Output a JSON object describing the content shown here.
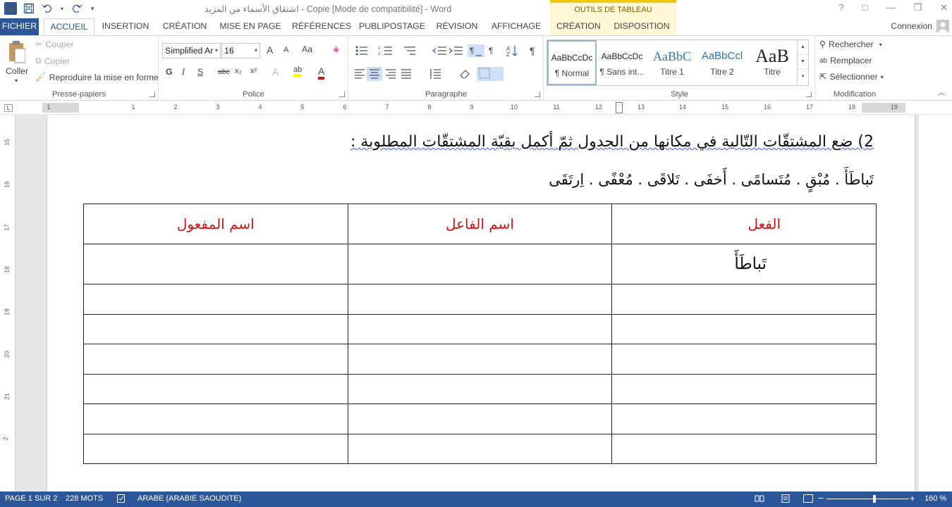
{
  "app": {
    "window_title": "اشتقاق الأسماء من المزيد - Copie [Mode de compatibilité] - Word",
    "contextual_group": "OUTILS DE TABLEAU",
    "window_controls": [
      "?",
      "□",
      "—",
      "❐",
      "✕"
    ]
  },
  "tabs": [
    {
      "label": "FICHIER"
    },
    {
      "label": "ACCUEIL"
    },
    {
      "label": "INSERTION"
    },
    {
      "label": "CRÉATION"
    },
    {
      "label": "MISE EN PAGE"
    },
    {
      "label": "RÉFÉRENCES"
    },
    {
      "label": "PUBLIPOSTAGE"
    },
    {
      "label": "RÉVISION"
    },
    {
      "label": "AFFICHAGE"
    },
    {
      "label": "CRÉATION"
    },
    {
      "label": "DISPOSITION"
    }
  ],
  "account": {
    "label": "Connexion"
  },
  "ribbon": {
    "clipboard": {
      "paste": "Coller",
      "cut": "Couper",
      "copy": "Copier",
      "format_painter": "Reproduire la mise en forme",
      "label": "Presse-papiers"
    },
    "font": {
      "family": "Simplified Ar",
      "size": "16",
      "label": "Police",
      "grow": "A",
      "shrink": "A",
      "case": "Aa",
      "bold": "G",
      "italic": "I",
      "underline": "S",
      "strike": "abc",
      "sub": "x₂",
      "sup": "x²",
      "text_effects": "A",
      "highlight": "ab",
      "color": "A"
    },
    "paragraph": {
      "label": "Paragraphe"
    },
    "styles": {
      "label": "Style",
      "items": [
        {
          "sample": "AaBbCcDc",
          "name": "¶ Normal"
        },
        {
          "sample": "AaBbCcDc",
          "name": "¶ Sans int..."
        },
        {
          "sample": "AaBbC",
          "name": "Titre 1"
        },
        {
          "sample": "AaBbCcl",
          "name": "Titre 2"
        },
        {
          "sample": "AaB",
          "name": "Titre"
        }
      ]
    },
    "editing": {
      "label": "Modification",
      "find": "Rechercher",
      "replace": "Remplacer",
      "select": "Sélectionner"
    }
  },
  "ruler": {
    "numbers": [
      "1",
      "1",
      "2",
      "3",
      "4",
      "5",
      "6",
      "7",
      "8",
      "9",
      "10",
      "11",
      "12",
      "13",
      "14",
      "15",
      "16",
      "17",
      "18",
      "19"
    ],
    "vertical_numbers": [
      "15",
      "16",
      "17",
      "18",
      "19",
      "20",
      "21",
      "2"
    ]
  },
  "document": {
    "question": "2) ضع المشتقّات التّالية في مكانها من الجدول ثمّ أكمل بقيّة المشتقّات المطلوبة :",
    "words": "تَباطَأَ . مُبْقٍ . مُتَسامًى . أَخفَى . تَلاقَى . مُعْفًى . اِرتَقَى",
    "table": {
      "headers": [
        "الفعل",
        "اسم الفاعل",
        "اسم المفعول"
      ],
      "rows": [
        [
          "تَباطَأَ",
          "",
          ""
        ],
        [
          "",
          "",
          ""
        ],
        [
          "",
          "",
          ""
        ],
        [
          "",
          "",
          ""
        ],
        [
          "",
          "",
          ""
        ],
        [
          "",
          "",
          ""
        ],
        [
          "",
          "",
          ""
        ]
      ]
    }
  },
  "status": {
    "page": "PAGE 1 SUR 2",
    "words": "228 MOTS",
    "language": "ARABE (ARABIE SAOUDITE)",
    "zoom": "160 %",
    "zoom_minus": "−",
    "zoom_plus": "+"
  },
  "colors": {
    "accent": "#2b579a",
    "contextual": "#f2c811",
    "header_text": "#d21414"
  }
}
